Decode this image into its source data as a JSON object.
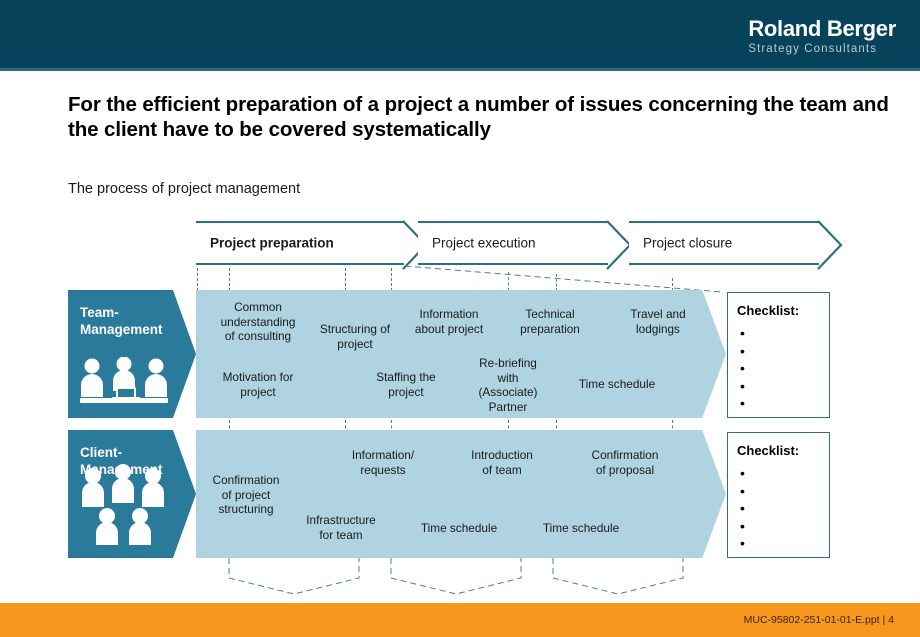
{
  "header": {
    "logo_main": "Roland Berger",
    "logo_sub": "Strategy Consultants",
    "bg_color": "#06435a"
  },
  "slide": {
    "title": "For the efficient preparation of a project a number of issues concerning the team and the client have to be covered systematically",
    "subtitle": "The process of project management"
  },
  "process": {
    "phases": [
      {
        "label": "Project preparation",
        "active": true
      },
      {
        "label": "Project execution",
        "active": false
      },
      {
        "label": "Project closure",
        "active": false
      }
    ],
    "border_color": "#2e6e85"
  },
  "rows": [
    {
      "caption": "Team-\nManagement",
      "caption_line1": "Team-",
      "caption_line2": "Management",
      "icon": "team-meeting-icon",
      "items_top": [
        "Common\nunderstanding\nof consulting",
        "Structuring of\nproject",
        "Information\nabout project",
        "Technical\npreparation",
        "Travel and\nlodgings"
      ],
      "items_bottom": [
        "Motivation for\nproject",
        "Staffing the\nproject",
        "Re-briefing\nwith\n(Associate)\nPartner",
        "Time schedule"
      ],
      "checklist": {
        "title": "Checklist:",
        "bullets": [
          "",
          "",
          "",
          "",
          ""
        ]
      }
    },
    {
      "caption_line1": "Client-",
      "caption_line2": "Management",
      "icon": "client-group-icon",
      "items_top": [
        "Information/\nrequests",
        "Introduction\nof team",
        "Confirmation\nof proposal"
      ],
      "items_bottom": [
        "Confirmation\nof project\nstructuring",
        "Infrastructure\nfor team",
        "Time schedule",
        "Time schedule"
      ],
      "checklist": {
        "title": "Checklist:",
        "bullets": [
          "",
          "",
          "",
          "",
          ""
        ]
      }
    }
  ],
  "colors": {
    "panel_teal": "#2a7a9b",
    "body_light_blue": "#afd3e0",
    "accent_orange": "#f7971d",
    "guide_dash": "#4a7f99"
  },
  "footer": {
    "document_id": "MUC-95802-251-01-01-E.ppt",
    "separator": "|",
    "page_number": "4",
    "meta": "MUC-95802-251-01-01-E.ppt   |   4"
  }
}
